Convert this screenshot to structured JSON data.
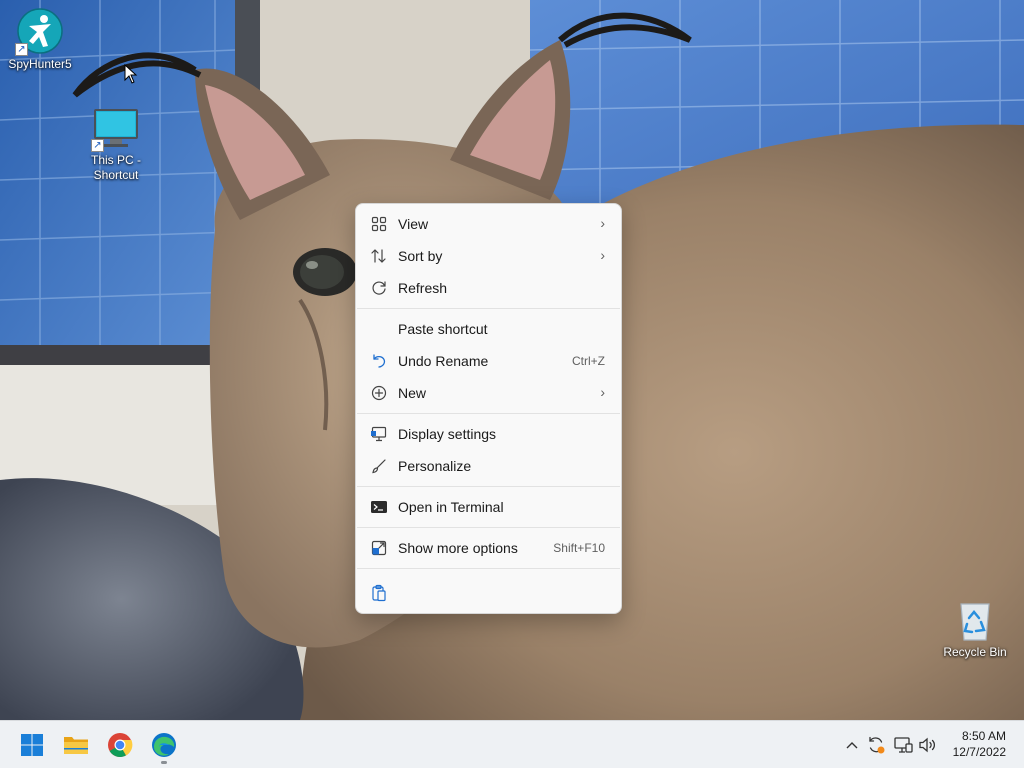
{
  "desktop": {
    "icons": [
      {
        "label": "SpyHunter5",
        "icon": "spyhunter-icon"
      },
      {
        "label": "This PC - Shortcut",
        "icon": "monitor-icon"
      },
      {
        "label": "Recycle Bin",
        "icon": "recycle-bin-icon"
      }
    ]
  },
  "context_menu": {
    "items": [
      {
        "label": "View",
        "icon": "grid-icon",
        "submenu": true
      },
      {
        "label": "Sort by",
        "icon": "sort-icon",
        "submenu": true
      },
      {
        "label": "Refresh",
        "icon": "refresh-icon"
      },
      {
        "label": "Paste shortcut",
        "icon": ""
      },
      {
        "label": "Undo Rename",
        "icon": "undo-icon",
        "accel": "Ctrl+Z"
      },
      {
        "label": "New",
        "icon": "plus-circle-icon",
        "submenu": true
      },
      {
        "label": "Display settings",
        "icon": "display-icon"
      },
      {
        "label": "Personalize",
        "icon": "brush-icon"
      },
      {
        "label": "Open in Terminal",
        "icon": "terminal-icon"
      },
      {
        "label": "Show more options",
        "icon": "show-more-icon",
        "accel": "Shift+F10"
      }
    ],
    "bottom_icons": [
      "paste-icon"
    ]
  },
  "taskbar": {
    "apps": [
      "windows-start-icon",
      "file-explorer-icon",
      "chrome-icon",
      "edge-icon"
    ],
    "tray": [
      "chevron-up-icon",
      "update-icon",
      "network-icon",
      "volume-icon"
    ],
    "clock": {
      "time": "8:50 AM",
      "date": "12/7/2022"
    }
  },
  "colors": {
    "accent": "#0067c0",
    "menu_bg": "#f9f9f9",
    "taskbar_bg": "#eef1f4"
  }
}
